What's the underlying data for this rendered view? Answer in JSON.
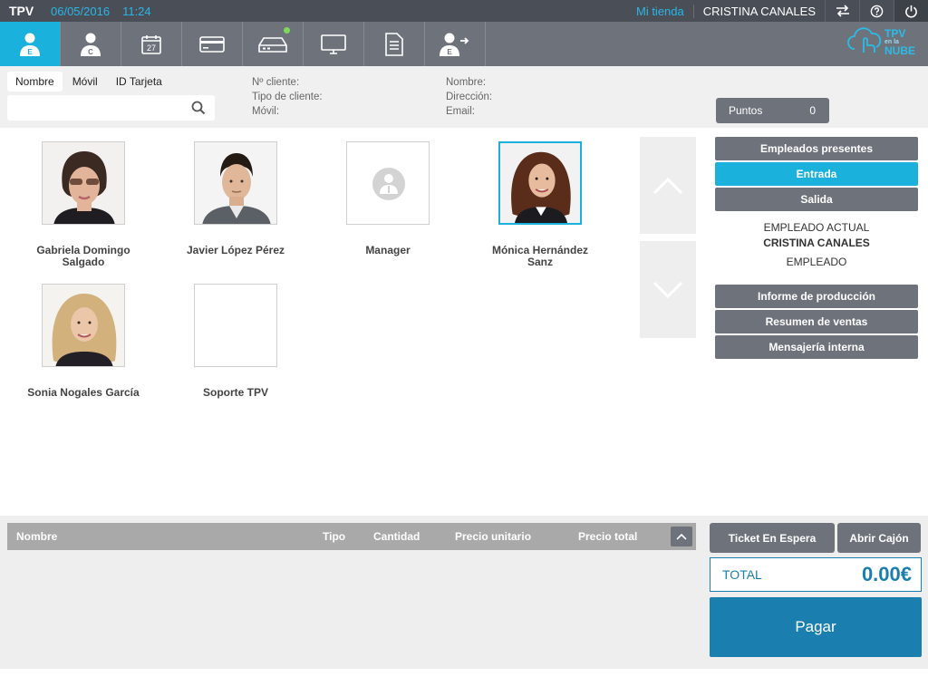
{
  "topbar": {
    "app_name": "TPV",
    "date": "06/05/2016",
    "time": "11:24",
    "store": "Mi tienda",
    "user": "CRISTINA CANALES",
    "icons": [
      "swap-arrows-icon",
      "help-icon",
      "power-icon"
    ]
  },
  "toolbar": {
    "tools": [
      {
        "name": "employees-tool",
        "icon": "employee-icon",
        "glyph": "E",
        "active": true
      },
      {
        "name": "customers-tool",
        "icon": "customer-icon",
        "glyph": "C"
      },
      {
        "name": "calendar-tool",
        "icon": "calendar-icon",
        "glyph": "27"
      },
      {
        "name": "card-tool",
        "icon": "credit-card-icon"
      },
      {
        "name": "drawer-tool",
        "icon": "cash-drawer-icon"
      },
      {
        "name": "screen-tool",
        "icon": "monitor-icon"
      },
      {
        "name": "document-tool",
        "icon": "document-icon"
      },
      {
        "name": "logout-employee-tool",
        "icon": "employee-exit-icon",
        "glyph": "E"
      }
    ],
    "logo_line1": "TPV",
    "logo_line2": "NUBE",
    "logo_small": "en la"
  },
  "filter": {
    "tabs": [
      "Nombre",
      "Móvil",
      "ID Tarjeta"
    ],
    "search_placeholder": "",
    "labels_col1": [
      "Nº cliente:",
      "Tipo de cliente:",
      "Móvil:"
    ],
    "labels_col2": [
      "Nombre:",
      "Dirección:",
      "Email:"
    ],
    "points_label": "Puntos",
    "points_value": "0"
  },
  "employees": [
    {
      "name_line1": "Gabriela Domingo",
      "name_line2": "Salgado",
      "photo": "woman-sunglasses"
    },
    {
      "name_line1": "Javier López Pérez",
      "name_line2": "",
      "photo": "man"
    },
    {
      "name_line1": "Manager",
      "name_line2": "",
      "photo": "placeholder"
    },
    {
      "name_line1": "Mónica Hernández",
      "name_line2": "Sanz",
      "photo": "woman-brunette",
      "selected": true
    },
    {
      "name_line1": "Sonia Nogales García",
      "name_line2": "",
      "photo": "woman-blonde"
    },
    {
      "name_line1": "Soporte TPV",
      "name_line2": "",
      "photo": "empty"
    }
  ],
  "right_panel": {
    "present_button": "Empleados presentes",
    "entry_button": "Entrada",
    "exit_button": "Salida",
    "current_label": "EMPLEADO ACTUAL",
    "current_name": "CRISTINA CANALES",
    "current_role": "EMPLEADO",
    "production_button": "Informe de producción",
    "sales_button": "Resumen de ventas",
    "messages_button": "Mensajería interna"
  },
  "ticket_table": {
    "columns": [
      "Nombre",
      "Tipo",
      "Cantidad",
      "Precio unitario",
      "Precio total"
    ],
    "rows": []
  },
  "actions": {
    "hold_ticket": "Ticket En Espera",
    "open_drawer": "Abrir Cajón",
    "total_label": "TOTAL",
    "total_value": "0.00€",
    "pay_button": "Pagar"
  },
  "colors": {
    "accent": "#1ab2dc",
    "dark_blue": "#1a7fae",
    "grey_button": "#6e737b",
    "top_bar": "#4a4f57"
  }
}
